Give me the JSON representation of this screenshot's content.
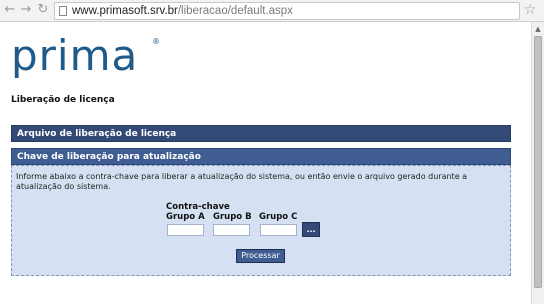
{
  "browser": {
    "back_icon": "back-arrow-icon",
    "forward_icon": "forward-arrow-icon",
    "reload_icon": "reload-icon",
    "url_domain": "www.primasoft.srv.br",
    "url_path": "/liberacao/default.aspx",
    "bookmark_icon": "star-icon"
  },
  "logo": {
    "text": "prima",
    "color": "#1e5a8a",
    "mark": "®"
  },
  "page": {
    "heading": "Liberação de licença"
  },
  "sections": {
    "file_release": "Arquivo de liberação de licença",
    "update_key": "Chave de liberação para atualização"
  },
  "form": {
    "info": "Informe abaixo a contra-chave para liberar a atualização do sistema, ou então envie o arquivo gerado durante a atualização do sistema.",
    "contra_chave_label": "Contra-chave",
    "group_a_label": "Grupo A",
    "group_b_label": "Grupo B",
    "group_c_label": "Grupo C",
    "group_a_value": "",
    "group_b_value": "",
    "group_c_value": "",
    "browse_label": "...",
    "process_label": "Processar"
  },
  "colors": {
    "bar_dark": "#344a76",
    "bar_medium": "#3f5d92",
    "panel_bg": "#d5e1f2"
  }
}
